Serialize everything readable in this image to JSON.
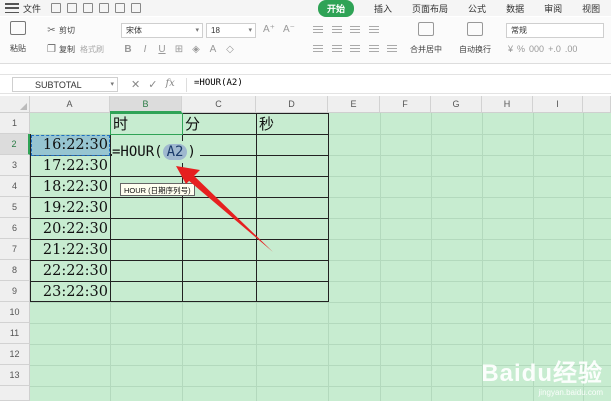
{
  "menubar": {
    "file": "文件",
    "tabs": [
      {
        "label": "开始",
        "active": true
      },
      {
        "label": "插入",
        "active": false
      },
      {
        "label": "页面布局",
        "active": false
      },
      {
        "label": "公式",
        "active": false
      },
      {
        "label": "数据",
        "active": false
      },
      {
        "label": "审阅",
        "active": false
      },
      {
        "label": "视图",
        "active": false
      }
    ],
    "accent_color": "#2fa356"
  },
  "ribbon": {
    "paste": "粘贴",
    "cut": "剪切",
    "copy": "复制",
    "format_painter": "格式刷",
    "font_name": "宋体",
    "font_size": "18",
    "merge_center": "合并居中",
    "wrap_text": "自动换行",
    "number_format": "常规",
    "percent": "%",
    "thousands": "000",
    "decimal_inc": "+.0",
    "decimal_dec": ".00"
  },
  "formula_bar": {
    "name_box": "SUBTOTAL",
    "formula": "=HOUR(A2)"
  },
  "columns": [
    "A",
    "B",
    "C",
    "D",
    "E",
    "F",
    "G",
    "H",
    "I"
  ],
  "selected_column": "B",
  "rows": [
    "1",
    "2",
    "3",
    "4",
    "5",
    "6",
    "7",
    "8",
    "9",
    "10",
    "11",
    "12",
    "13"
  ],
  "selected_row": "2",
  "header_row": {
    "b": "时",
    "c": "分",
    "d": "秒"
  },
  "times": [
    "16:22:30",
    "17:22:30",
    "18:22:30",
    "19:22:30",
    "20:22:30",
    "21:22:30",
    "22:22:30",
    "23:22:30"
  ],
  "edit_cell": {
    "prefix": "=HOUR(",
    "ref": "A2",
    "suffix": ")"
  },
  "tooltip": "HOUR (日期序列号)",
  "watermark": {
    "logo": "Baidu经验",
    "url": "jingyan.baidu.com"
  }
}
